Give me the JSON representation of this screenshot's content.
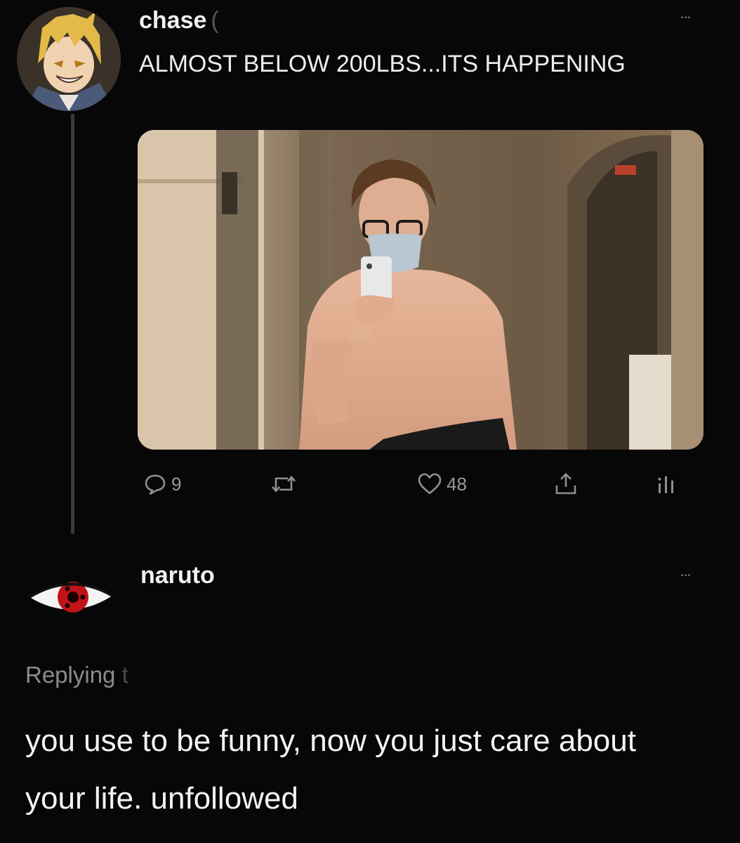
{
  "tweet": {
    "author": "chase",
    "handle_stub": "(",
    "more_label": "...",
    "text": "ALMOST BELOW 200LBS...ITS HAPPENING",
    "stats": {
      "replies": "9",
      "retweets": "",
      "likes": "48"
    },
    "icons": [
      "reply-icon",
      "retweet-icon",
      "like-icon",
      "share-icon",
      "analytics-icon"
    ]
  },
  "reply": {
    "author": "naruto",
    "more_label": "...",
    "replying_label": "Replying",
    "replying_stub": "t",
    "text": "you use to be funny, now you just care about your life. unfollowed"
  },
  "colors": {
    "background": "#070707",
    "text": "#eeeeee",
    "muted": "#8c8c8c",
    "sharingan_red": "#c0141a"
  }
}
